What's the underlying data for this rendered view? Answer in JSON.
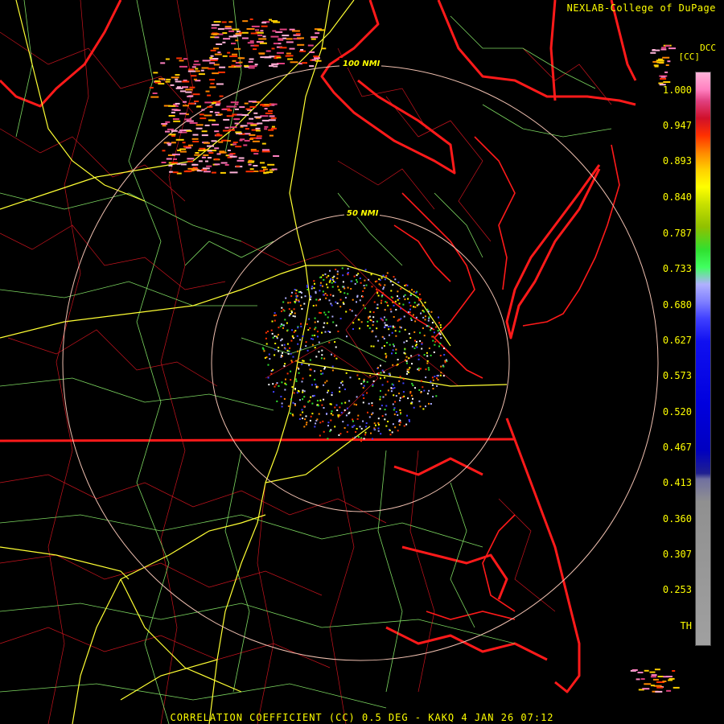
{
  "header": {
    "credit": "NEXLAB-College of DuPage"
  },
  "map": {
    "range_rings": [
      {
        "label": "50 NMI"
      },
      {
        "label": "100 NMI"
      }
    ],
    "colors": {
      "state_borders": "#ff1a1a",
      "county_lines": "#c8141e",
      "roads_primary": "#ffff33",
      "roads_secondary": "#7dd860",
      "range_rings": "#f0c0b0"
    }
  },
  "legend": {
    "product": "DCC",
    "unit": "[CC]",
    "labels": [
      "1.000",
      "0.947",
      "0.893",
      "0.840",
      "0.787",
      "0.733",
      "0.680",
      "0.627",
      "0.573",
      "0.520",
      "0.467",
      "0.413",
      "0.360",
      "0.307",
      "0.253",
      "TH"
    ]
  },
  "footer": {
    "caption": "CORRELATION COEFFICIENT (CC) 0.5 DEG - KAKQ 4 JAN 26 07:12"
  }
}
